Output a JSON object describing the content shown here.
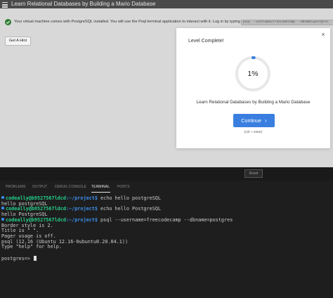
{
  "titlebar": {
    "title": "Learn Relational Databases by Building a Mario Database"
  },
  "notice": {
    "text": "Your virtual machine comes with PostgreSQL installed. You will use the Psql terminal application to interact with it. Log in by typing",
    "command": "psql --username=freecodecamp --dbname=postgres"
  },
  "hint_button": {
    "label": "Get A Hint"
  },
  "modal": {
    "close": "×",
    "title": "Level Complete!",
    "progress": {
      "text": "1%",
      "value": 0.01,
      "track_color": "#e8e8e8",
      "fill_color": "#3a7fe0"
    },
    "course_name": "Learn Relational Databases by Building a Mario Database",
    "continue_label": "Continue",
    "continue_chevron": "›",
    "shortcut": "(ctrl + enter)"
  },
  "reset_button": {
    "label": "Reset"
  },
  "panel_tabs": [
    "PROBLEMS",
    "OUTPUT",
    "DEBUG CONSOLE",
    "TERMINAL",
    "PORTS"
  ],
  "terminal": {
    "prompt_user": "codeally@b9527567ldcd",
    "prompt_path": ":~/project$",
    "lines": [
      {
        "cmd": " echo hello postgreSQL"
      },
      {
        "out": "hello postgreSQL"
      },
      {
        "cmd": " echo hello PostgreSQL"
      },
      {
        "out": "hello PostgreSQL"
      },
      {
        "cmd": " psql --username=freecodecamp --dbname=postgres"
      },
      {
        "out": "Border style is 2."
      },
      {
        "out": "Title is \" \"."
      },
      {
        "out": "Pager usage is off."
      },
      {
        "out": "psql (12.16 (Ubuntu 12.16-0ubuntu0.20.04.1))"
      },
      {
        "out": "Type \"help\" for help."
      },
      {
        "out": ""
      },
      {
        "out": "postgres=> "
      }
    ],
    "colors": {
      "user": "#23d18b",
      "path": "#3b8eea",
      "dot": "#3794ff"
    }
  }
}
